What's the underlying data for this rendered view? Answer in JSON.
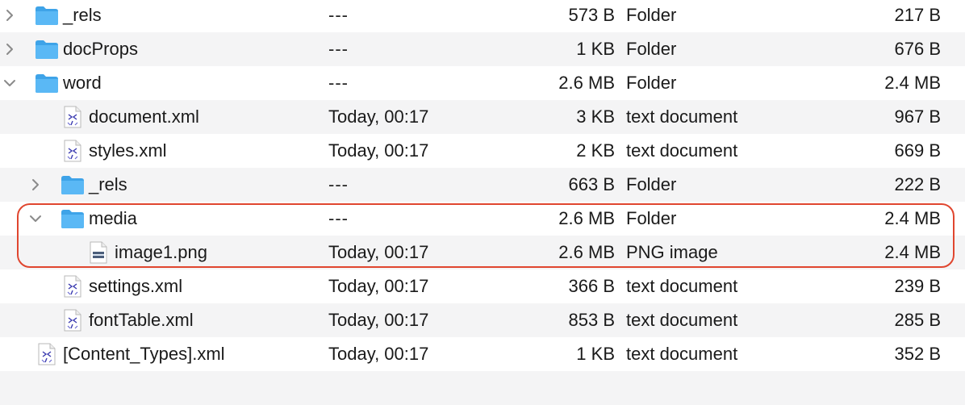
{
  "rows": [
    {
      "level": 0,
      "chev": "right",
      "icon": "folder-icon",
      "name": "_rels",
      "date": "---",
      "size": "573 B",
      "kind": "Folder",
      "comp": "217 B",
      "alt": false
    },
    {
      "level": 0,
      "chev": "right",
      "icon": "folder-icon",
      "name": "docProps",
      "date": "---",
      "size": "1 KB",
      "kind": "Folder",
      "comp": "676 B",
      "alt": true
    },
    {
      "level": 0,
      "chev": "down",
      "icon": "folder-icon",
      "name": "word",
      "date": "---",
      "size": "2.6 MB",
      "kind": "Folder",
      "comp": "2.4 MB",
      "alt": false
    },
    {
      "level": 1,
      "chev": "",
      "icon": "xml-document-icon",
      "name": "document.xml",
      "date": "Today, 00:17",
      "size": "3 KB",
      "kind": "text document",
      "comp": "967 B",
      "alt": true
    },
    {
      "level": 1,
      "chev": "",
      "icon": "xml-document-icon",
      "name": "styles.xml",
      "date": "Today, 00:17",
      "size": "2 KB",
      "kind": "text document",
      "comp": "669 B",
      "alt": false
    },
    {
      "level": 1,
      "chev": "right",
      "icon": "folder-icon",
      "name": "_rels",
      "date": "---",
      "size": "663 B",
      "kind": "Folder",
      "comp": "222 B",
      "alt": true
    },
    {
      "level": 1,
      "chev": "down",
      "icon": "folder-icon",
      "name": "media",
      "date": "---",
      "size": "2.6 MB",
      "kind": "Folder",
      "comp": "2.4 MB",
      "alt": false
    },
    {
      "level": 2,
      "chev": "",
      "icon": "png-image-icon",
      "name": "image1.png",
      "date": "Today, 00:17",
      "size": "2.6 MB",
      "kind": "PNG image",
      "comp": "2.4 MB",
      "alt": true
    },
    {
      "level": 1,
      "chev": "",
      "icon": "xml-document-icon",
      "name": "settings.xml",
      "date": "Today, 00:17",
      "size": "366 B",
      "kind": "text document",
      "comp": "239 B",
      "alt": false
    },
    {
      "level": 1,
      "chev": "",
      "icon": "xml-document-icon",
      "name": "fontTable.xml",
      "date": "Today, 00:17",
      "size": "853 B",
      "kind": "text document",
      "comp": "285 B",
      "alt": true
    },
    {
      "level": 0,
      "chev": "",
      "icon": "xml-document-icon",
      "name": "[Content_Types].xml",
      "date": "Today, 00:17",
      "size": "1 KB",
      "kind": "text document",
      "comp": "352 B",
      "alt": false
    },
    {
      "level": 0,
      "chev": "",
      "icon": "",
      "name": "",
      "date": "",
      "size": "",
      "kind": "",
      "comp": "",
      "alt": true
    }
  ],
  "colors": {
    "folder": "#5ab8f5",
    "folder_tab": "#3ea3e8",
    "highlight": "#e0462f",
    "alt_row": "#f4f4f5"
  }
}
